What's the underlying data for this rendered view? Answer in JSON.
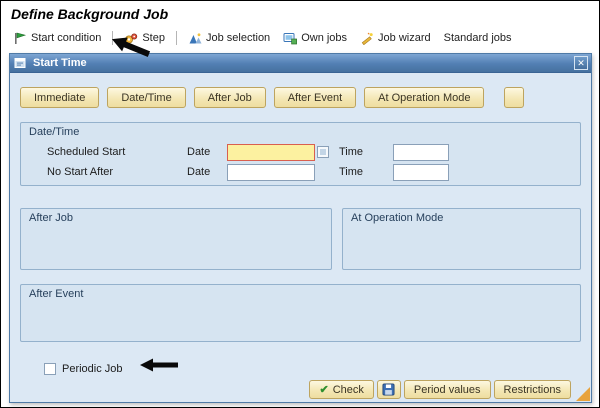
{
  "window": {
    "title": "Define Background Job"
  },
  "toolbar": {
    "start_condition": "Start condition",
    "step": "Step",
    "job_selection": "Job selection",
    "own_jobs": "Own jobs",
    "job_wizard": "Job wizard",
    "standard_jobs": "Standard jobs"
  },
  "icons": {
    "start_condition": "flag-icon",
    "step": "gears-icon",
    "job_selection": "job-selection-icon",
    "own_jobs": "monitor-icon",
    "job_wizard": "wand-icon",
    "dialog_title": "window-icon",
    "close_glyph": "✕",
    "check_glyph": "✔",
    "save": "floppy-icon",
    "annotation": "black-arrow-icon",
    "resize": "resize-grip"
  },
  "dialog": {
    "title": "Start Time",
    "close_glyph": "✕",
    "tab_buttons": {
      "immediate": "Immediate",
      "date_time": "Date/Time",
      "after_job": "After Job",
      "after_event": "After Event",
      "at_operation_mode": "At Operation Mode"
    },
    "groups": {
      "date_time": {
        "title": "Date/Time",
        "rows": [
          {
            "label": "Scheduled Start",
            "date_label": "Date",
            "date_value": "",
            "time_label": "Time",
            "time_value": ""
          },
          {
            "label": "No Start After",
            "date_label": "Date",
            "date_value": "",
            "time_label": "Time",
            "time_value": ""
          }
        ]
      },
      "after_job": {
        "title": "After Job"
      },
      "at_operation_mode": {
        "title": "At Operation Mode"
      },
      "after_event": {
        "title": "After Event"
      }
    },
    "periodic_job": {
      "label": "Periodic Job",
      "checked": false
    },
    "footer": {
      "check": "Check",
      "check_glyph": "✔",
      "period_values": "Period values",
      "restrictions": "Restrictions"
    }
  }
}
